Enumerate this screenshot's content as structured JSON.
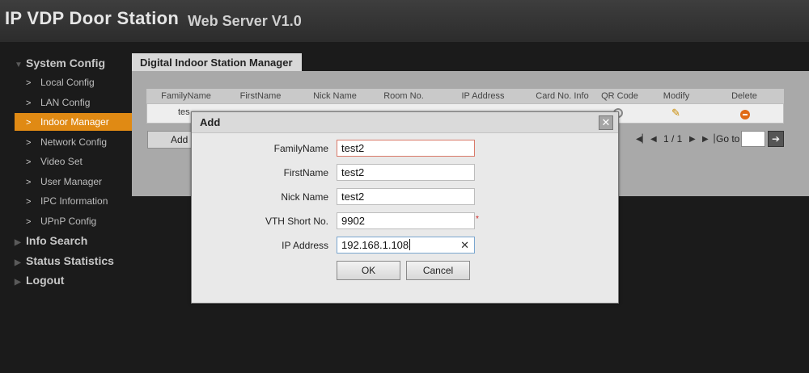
{
  "header": {
    "title": "IP VDP Door Station",
    "subtitle": "Web Server V1.0"
  },
  "sidebar": {
    "sections": [
      {
        "label": "System Config",
        "expanded": true
      },
      {
        "label": "Info Search",
        "expanded": false
      },
      {
        "label": "Status Statistics",
        "expanded": false
      },
      {
        "label": "Logout",
        "expanded": false
      }
    ],
    "items": [
      {
        "label": "Local Config"
      },
      {
        "label": "LAN Config"
      },
      {
        "label": "Indoor Manager",
        "active": true
      },
      {
        "label": "Network Config"
      },
      {
        "label": "Video Set"
      },
      {
        "label": "User Manager"
      },
      {
        "label": "IPC Information"
      },
      {
        "label": "UPnP Config"
      }
    ]
  },
  "main": {
    "tab": "Digital Indoor Station Manager",
    "columns": [
      "FamilyName",
      "FirstName",
      "Nick Name",
      "Room No.",
      "IP Address",
      "Card No. Info",
      "QR Code",
      "Modify",
      "Delete"
    ],
    "row": {
      "family": "tes"
    },
    "add_label": "Add",
    "pager": {
      "page": "1 / 1",
      "goto_label": "Go to"
    }
  },
  "dialog": {
    "title": "Add",
    "fields": [
      {
        "label": "FamilyName",
        "value": "test2"
      },
      {
        "label": "FirstName",
        "value": "test2"
      },
      {
        "label": "Nick Name",
        "value": "test2"
      },
      {
        "label": "VTH Short No.",
        "value": "9902",
        "required": "*"
      },
      {
        "label": "IP Address",
        "value": "192.168.1.108"
      }
    ],
    "ok_label": "OK",
    "cancel_label": "Cancel"
  },
  "colors": {
    "accent": "#e08a14",
    "header": "#333333",
    "dialog": "#e9e9e9"
  },
  "icons": [
    "triangle-down-icon",
    "triangle-right-icon",
    "chevron-right-icon",
    "qr-code-icon",
    "pencil-icon",
    "delete-icon",
    "first-page-icon",
    "prev-page-icon",
    "next-page-icon",
    "last-page-icon",
    "arrow-right-icon",
    "close-icon",
    "clear-icon"
  ]
}
